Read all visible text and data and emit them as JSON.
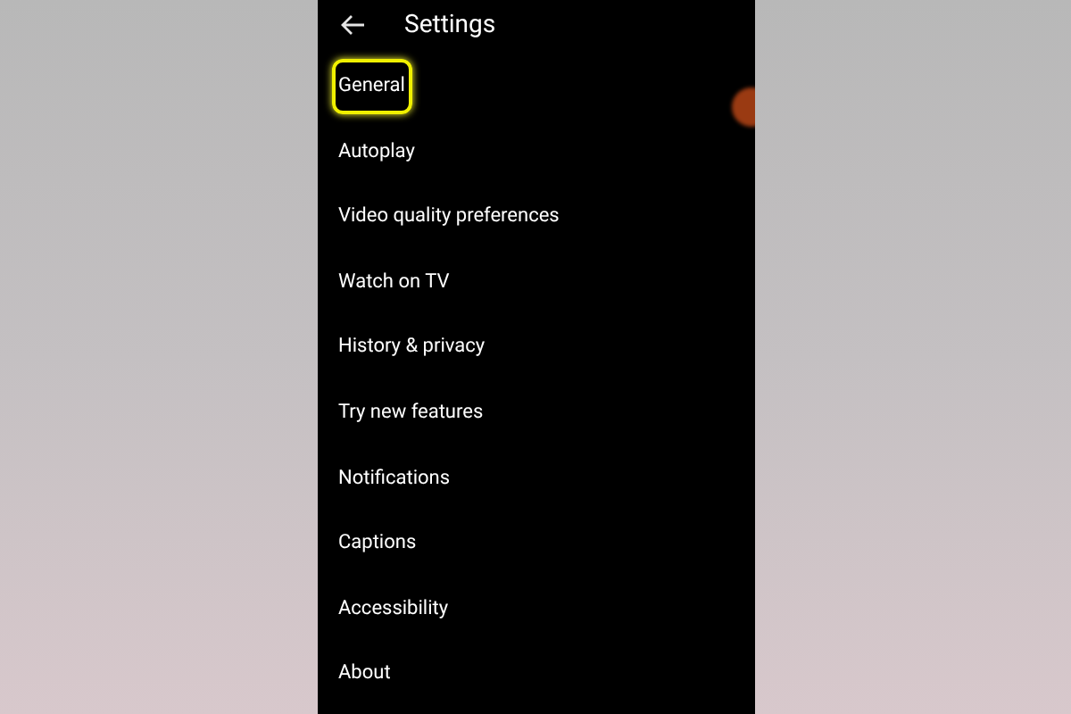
{
  "header": {
    "title": "Settings"
  },
  "items": [
    {
      "label": "General",
      "highlighted": true
    },
    {
      "label": "Autoplay",
      "highlighted": false
    },
    {
      "label": "Video quality preferences",
      "highlighted": false
    },
    {
      "label": "Watch on TV",
      "highlighted": false
    },
    {
      "label": "History & privacy",
      "highlighted": false
    },
    {
      "label": "Try new features",
      "highlighted": false
    },
    {
      "label": "Notifications",
      "highlighted": false
    },
    {
      "label": "Captions",
      "highlighted": false
    },
    {
      "label": "Accessibility",
      "highlighted": false
    },
    {
      "label": "About",
      "highlighted": false
    }
  ]
}
